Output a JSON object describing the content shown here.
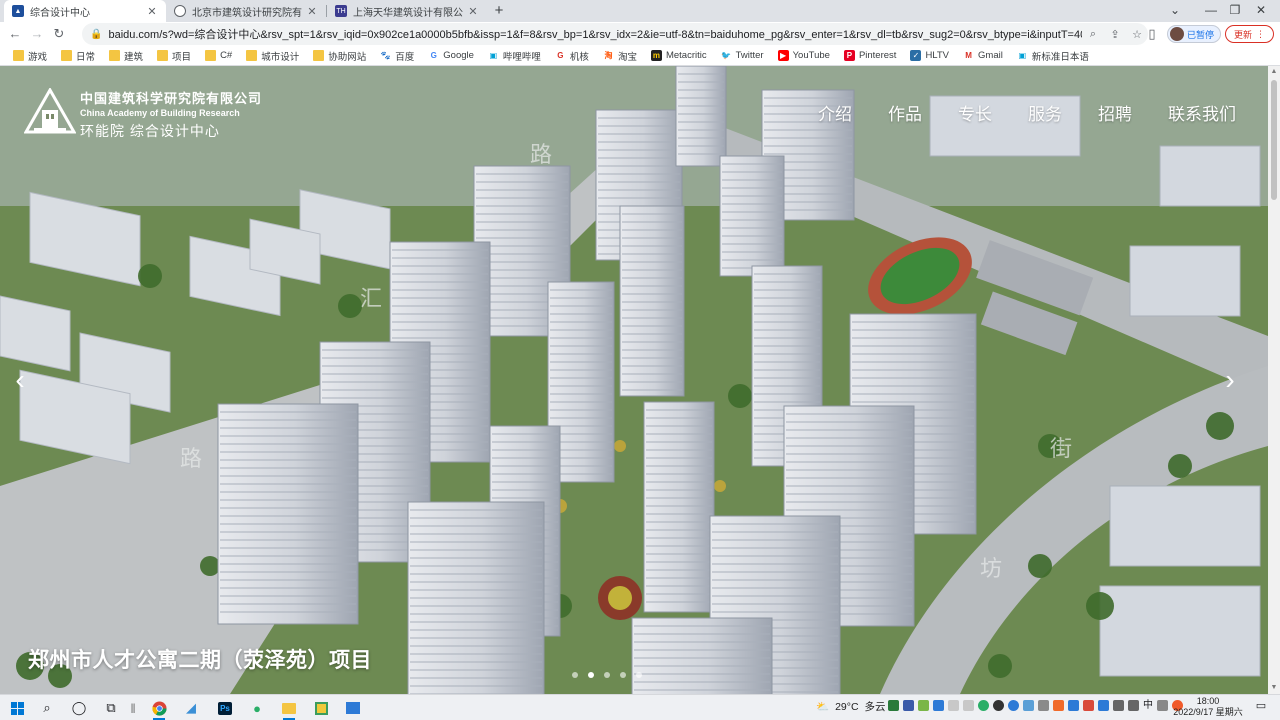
{
  "browser": {
    "tabs": [
      {
        "title": "综合设计中心",
        "active": true,
        "favicon_color": "#1e4f9c"
      },
      {
        "title": "北京市建筑设计研究院有限公司",
        "active": false,
        "favicon_color": "#5f6368"
      },
      {
        "title": "上海天华建筑设计有限公司官网",
        "active": false,
        "favicon_color": "#3b3b8f",
        "favicon_text": "TH"
      }
    ],
    "new_tab_label": "+",
    "window_controls": [
      "⌄",
      "—",
      "❐",
      "✕"
    ],
    "url": "baidu.com/s?wd=综合设计中心&rsv_spt=1&rsv_iqid=0x902ce1a0000b5bfb&issp=1&f=8&rsv_bp=1&rsv_idx=2&ie=utf-8&tn=baiduhome_pg&rsv_enter=1&rsv_dl=tb&rsv_sug2=0&rsv_btype=i&inputT=4034&rsv_sug4...",
    "profile_label": "已暂停",
    "update_label": "更新",
    "bookmarks": [
      {
        "label": "游戏",
        "icon": "folder"
      },
      {
        "label": "日常",
        "icon": "folder"
      },
      {
        "label": "建筑",
        "icon": "folder"
      },
      {
        "label": "项目",
        "icon": "folder"
      },
      {
        "label": "C#",
        "icon": "folder"
      },
      {
        "label": "城市设计",
        "icon": "folder"
      },
      {
        "label": "协助网站",
        "icon": "folder"
      },
      {
        "label": "百度",
        "icon": "baidu"
      },
      {
        "label": "Google",
        "icon": "google"
      },
      {
        "label": "哔哩哔哩",
        "icon": "bilibili"
      },
      {
        "label": "机核",
        "icon": "gcores"
      },
      {
        "label": "淘宝",
        "icon": "taobao"
      },
      {
        "label": "Metacritic",
        "icon": "metacritic"
      },
      {
        "label": "Twitter",
        "icon": "twitter"
      },
      {
        "label": "YouTube",
        "icon": "youtube"
      },
      {
        "label": "Pinterest",
        "icon": "pinterest"
      },
      {
        "label": "HLTV",
        "icon": "hltv"
      },
      {
        "label": "Gmail",
        "icon": "gmail"
      },
      {
        "label": "新标准日本语",
        "icon": "bilibili"
      }
    ]
  },
  "site": {
    "logo_cn": "中国建筑科学研究院有限公司",
    "logo_en": "China Academy of Building Research",
    "logo_sub": "环能院 综合设计中心",
    "nav": [
      "介绍",
      "作品",
      "专长",
      "服务",
      "招聘",
      "联系我们"
    ],
    "slide_title": "郑州市人才公寓二期（荥泽苑）项目",
    "prev_arrow": "‹",
    "next_arrow": "›",
    "slide_count": 5,
    "active_slide": 1
  },
  "taskbar": {
    "weather_temp": "29°C",
    "weather_desc": "多云",
    "ime": "中",
    "time": "18:00",
    "date": "2022/9/17 星期六"
  }
}
